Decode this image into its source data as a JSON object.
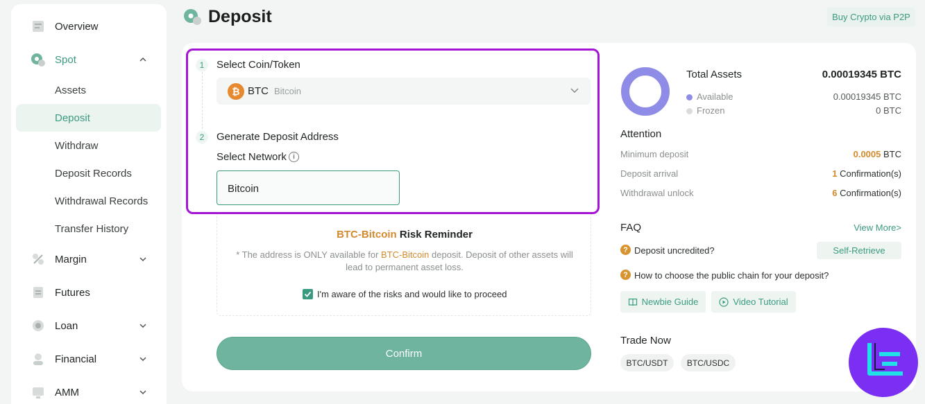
{
  "sidebar": {
    "items": [
      {
        "label": "Overview",
        "icon": "overview-icon"
      },
      {
        "label": "Spot",
        "icon": "spot-icon"
      },
      {
        "label": "Margin",
        "icon": "margin-icon"
      },
      {
        "label": "Futures",
        "icon": "futures-icon"
      },
      {
        "label": "Loan",
        "icon": "loan-icon"
      },
      {
        "label": "Financial",
        "icon": "financial-icon"
      },
      {
        "label": "AMM",
        "icon": "amm-icon"
      }
    ],
    "spot_sub": [
      "Assets",
      "Deposit",
      "Withdraw",
      "Deposit Records",
      "Withdrawal Records",
      "Transfer History"
    ],
    "active_sub": "Deposit"
  },
  "header": {
    "title": "Deposit",
    "p2p_button": "Buy Crypto via P2P"
  },
  "form": {
    "step1_num": "1",
    "step1_label": "Select Coin/Token",
    "coin_symbol": "BTC",
    "coin_name": "Bitcoin",
    "coin_icon_glyph": "₿",
    "step2_num": "2",
    "step2_label": "Generate Deposit Address",
    "network_label": "Select Network",
    "network_value": "Bitcoin",
    "risk_title_accent": "BTC-Bitcoin",
    "risk_title_rest": " Risk Reminder",
    "risk_body_pre": "* The address is ONLY available for ",
    "risk_body_accent": "BTC-Bitcoin",
    "risk_body_post": " deposit. Deposit of other assets will lead to permanent asset loss.",
    "checkbox_label": "I'm aware of the risks and would like to proceed",
    "checkbox_checked": true,
    "confirm_label": "Confirm"
  },
  "assets": {
    "title": "Total Assets",
    "total": "0.00019345 BTC",
    "available_label": "Available",
    "available_value": "0.00019345 BTC",
    "frozen_label": "Frozen",
    "frozen_value": "0 BTC",
    "available_color": "#8f8ce8",
    "frozen_color": "#d9dcdb"
  },
  "attention": {
    "title": "Attention",
    "rows": [
      {
        "key": "Minimum deposit",
        "accent": "0.0005",
        "rest": " BTC"
      },
      {
        "key": "Deposit arrival",
        "accent": "1",
        "rest": " Confirmation(s)"
      },
      {
        "key": "Withdrawal unlock",
        "accent": "6",
        "rest": " Confirmation(s)"
      }
    ]
  },
  "faq": {
    "title": "FAQ",
    "view_more": "View More>",
    "q1": "Deposit uncredited?",
    "self_retrieve": "Self-Retrieve",
    "q2": "How to choose the public chain for your deposit?",
    "newbie_guide": "Newbie Guide",
    "video_tutorial": "Video Tutorial"
  },
  "trade": {
    "title": "Trade Now",
    "pairs": [
      "BTC/USDT",
      "BTC/USDC"
    ]
  },
  "colors": {
    "accent": "#3a9a80",
    "highlight_box": "#a513d6",
    "warning": "#d38a2e"
  }
}
